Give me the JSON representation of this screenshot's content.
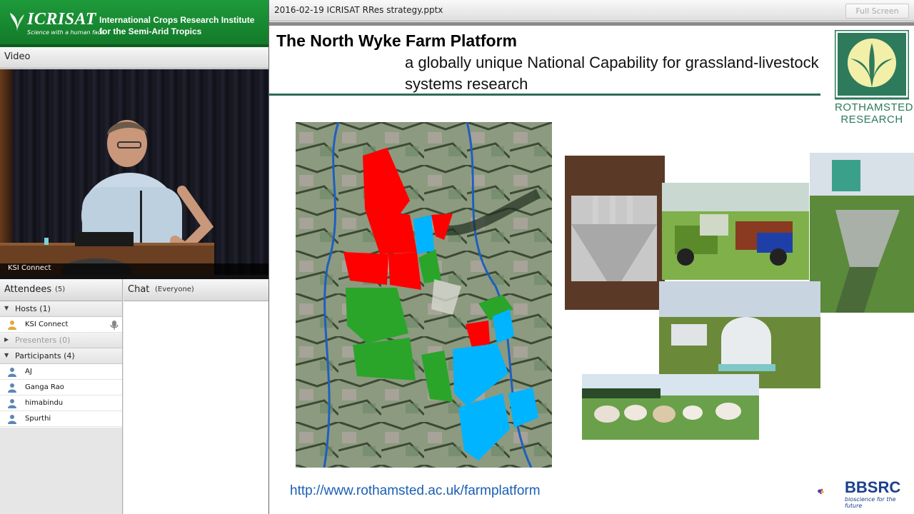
{
  "banner": {
    "logo_word": "ICRISAT",
    "logo_tagline": "Science with a human face",
    "institute_line1": "International Crops Research Institute",
    "institute_line2": "for the Semi-Arid Tropics"
  },
  "video_pod": {
    "title": "Video",
    "caption": "KSI Connect"
  },
  "attendees_pod": {
    "title": "Attendees",
    "count": "(5)",
    "groups": [
      {
        "label": "Hosts (1)",
        "members": [
          "KSI Connect"
        ]
      },
      {
        "label": "Presenters (0)",
        "members": []
      },
      {
        "label": "Participants (4)",
        "members": [
          "AJ",
          "Ganga Rao",
          "himabindu",
          "Spurthi"
        ]
      }
    ]
  },
  "chat_pod": {
    "title": "Chat",
    "scope": "(Everyone)"
  },
  "share_pod": {
    "filename": "2016-02-19 ICRISAT RRes strategy.pptx",
    "fullscreen_label": "Full Screen"
  },
  "slide": {
    "title": "The North Wyke Farm Platform",
    "subtitle": "a globally unique National Capability for grassland-livestock systems research",
    "url": "http://www.rothamsted.ac.uk/farmplatform",
    "rothamsted_line1": "ROTHAMSTED",
    "rothamsted_line2": "RESEARCH",
    "bbsrc_word": "BBSRC",
    "bbsrc_tagline": "bioscience for the future"
  },
  "colors": {
    "icrisat_green": "#1e9a3a",
    "slide_rule": "#2f6b54",
    "rothamsted_green": "#2e7a5c",
    "link_blue": "#1a5fb4",
    "bbsrc_blue": "#1a3f8c",
    "field_red": "#ff0000",
    "field_green": "#2aa52a",
    "field_blue": "#00b4ff"
  }
}
